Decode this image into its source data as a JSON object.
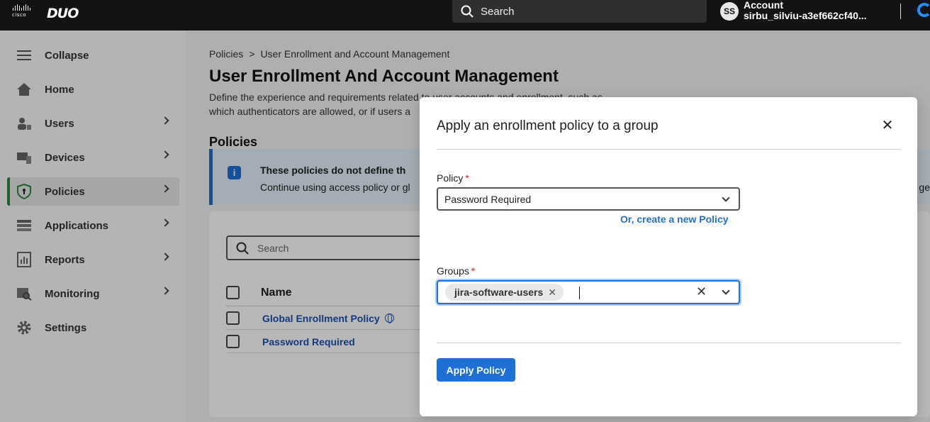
{
  "topbar": {
    "cisco_logo": "cisco",
    "duo_logo": "DUO",
    "search_label": "Search",
    "avatar_initials": "SS",
    "account_label": "Account",
    "account_name": "sirbu_silviu-a3ef662cf40..."
  },
  "sidebar": {
    "items": [
      {
        "label": "Collapse",
        "icon": "menu-icon"
      },
      {
        "label": "Home",
        "icon": "home-icon"
      },
      {
        "label": "Users",
        "icon": "users-icon"
      },
      {
        "label": "Devices",
        "icon": "devices-icon"
      },
      {
        "label": "Policies",
        "icon": "shield-icon"
      },
      {
        "label": "Applications",
        "icon": "applications-icon"
      },
      {
        "label": "Reports",
        "icon": "reports-icon"
      },
      {
        "label": "Monitoring",
        "icon": "monitoring-icon"
      },
      {
        "label": "Settings",
        "icon": "gear-icon"
      }
    ],
    "active": "Policies",
    "active_color": "#2e8540"
  },
  "main": {
    "breadcrumb": {
      "root": "Policies",
      "current": "User Enrollment and Account Management"
    },
    "title": "User Enrollment And Account Management",
    "description_line1": "Define the experience and requirements related to user accounts and enrollment, such as",
    "description_line2": "which authenticators are allowed, or if users a",
    "section_title": "Policies",
    "info": {
      "title": "These policies do not define th",
      "body": "Continue using access policy or gl",
      "body_tail": "ge"
    },
    "search_placeholder": "Search",
    "table": {
      "header": "Name",
      "rows": [
        {
          "name": "Global Enrollment Policy",
          "global": true
        },
        {
          "name": "Password Required",
          "global": false
        }
      ]
    }
  },
  "modal": {
    "title": "Apply an enrollment policy to a group",
    "policy_label": "Policy",
    "policy_value": "Password Required",
    "create_link": "Or, create a new Policy",
    "groups_label": "Groups",
    "groups_selected": [
      "jira-software-users"
    ],
    "required_mark": "*",
    "apply_button": "Apply Policy",
    "accent_color": "#1f6fd6"
  }
}
